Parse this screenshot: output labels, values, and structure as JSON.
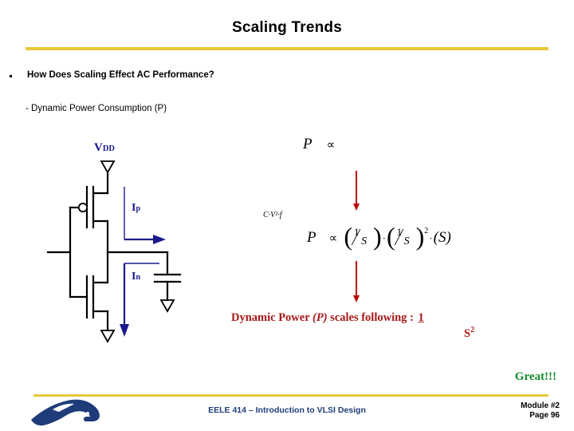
{
  "slide": {
    "title": "Scaling Trends",
    "accent_yellow": "#E8C83C",
    "navy": "#1A1A8C",
    "red": "#C00000",
    "conclusion_red": "#A81818",
    "green": "#178A2B"
  },
  "bullets": {
    "main": "How Does Scaling Effect AC Performance?",
    "sub": "- Dynamic Power Consumption  (P)"
  },
  "circuit": {
    "vdd_label": "V",
    "vdd_sub": "DD",
    "ip_label": "I",
    "ip_sub": "p",
    "in_label": "I",
    "in_sub": "n"
  },
  "equations": {
    "eq1_symbol": "P",
    "eq1_relation": "∝",
    "eq2_annotation": "C·V²·f",
    "eq2_symbol": "P",
    "eq2_relation": "∝",
    "eq2_num1": "1",
    "eq2_den1": "S",
    "eq2_num2": "1",
    "eq2_den2": "S",
    "eq2_exp2": "2",
    "eq2_last": "(S)",
    "eq2_dot": "·"
  },
  "conclusion": {
    "prefix": "Dynamic Power ",
    "variable": "(P)",
    "suffix": " scales following : ",
    "numerator": "1",
    "denominator": "S",
    "denominator_exp": "2",
    "praise": "Great!!!"
  },
  "footer": {
    "course": "EELE 414 – Introduction to VLSI Design",
    "module": "Module #2",
    "page": "Page 96"
  }
}
